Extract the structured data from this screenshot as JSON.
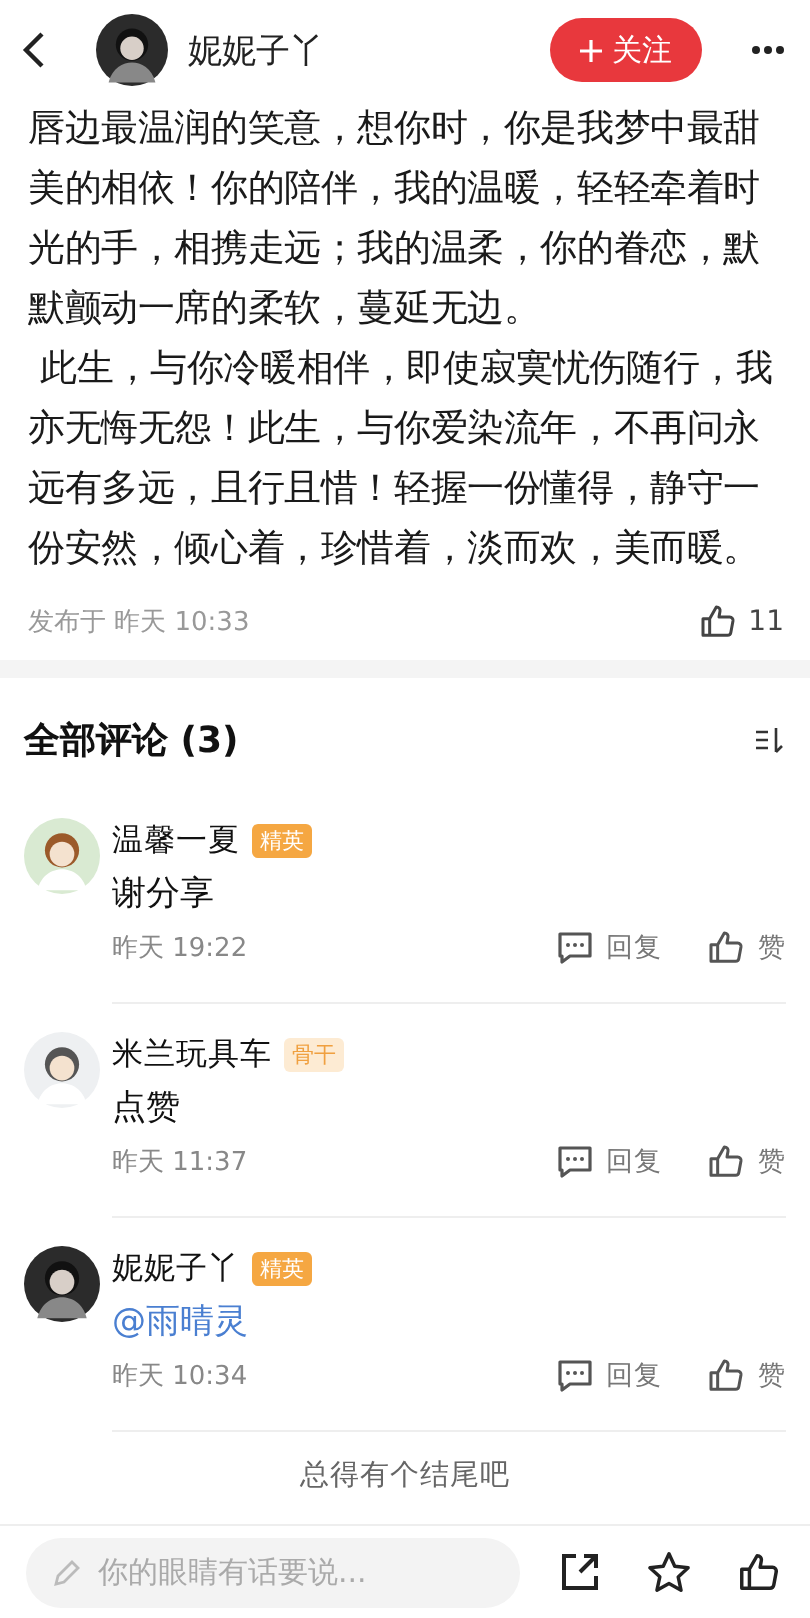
{
  "header": {
    "author": "妮妮子丫",
    "follow_label": "关注"
  },
  "article": {
    "paragraphs": [
      "唇边最温润的笑意，想你时，你是我梦中最甜美的相依！你的陪伴，我的温暖，轻轻牵着时光的手，相携走远；我的温柔，你的眷恋，默默颤动一席的柔软，蔓延无边。",
      " 此生，与你冷暖相伴，即使寂寞忧伤随行，我亦无悔无怨！此生，与你爱染流年，不再问永远有多远，且行且惜！轻握一份懂得，静守一份安然，倾心着，珍惜着，淡而欢，美而暖。"
    ],
    "published": "发布于 昨天 10:33",
    "likes": "11"
  },
  "comments_section": {
    "title": "全部评论 (3)",
    "comments": [
      {
        "user": "温馨一夏",
        "badge": {
          "text": "精英",
          "kind": "solid"
        },
        "text": "谢分享",
        "mention": false,
        "time": "昨天 19:22",
        "reply_label": "回复",
        "like_label": "赞"
      },
      {
        "user": "米兰玩具车",
        "badge": {
          "text": "骨干",
          "kind": "light"
        },
        "text": "点赞",
        "mention": false,
        "time": "昨天 11:37",
        "reply_label": "回复",
        "like_label": "赞"
      },
      {
        "user": "妮妮子丫",
        "badge": {
          "text": "精英",
          "kind": "solid"
        },
        "text": "@雨晴灵",
        "mention": true,
        "time": "昨天 10:34",
        "reply_label": "回复",
        "like_label": "赞"
      }
    ],
    "footer": "总得有个结尾吧"
  },
  "bottom_bar": {
    "placeholder": "你的眼睛有话要说..."
  }
}
